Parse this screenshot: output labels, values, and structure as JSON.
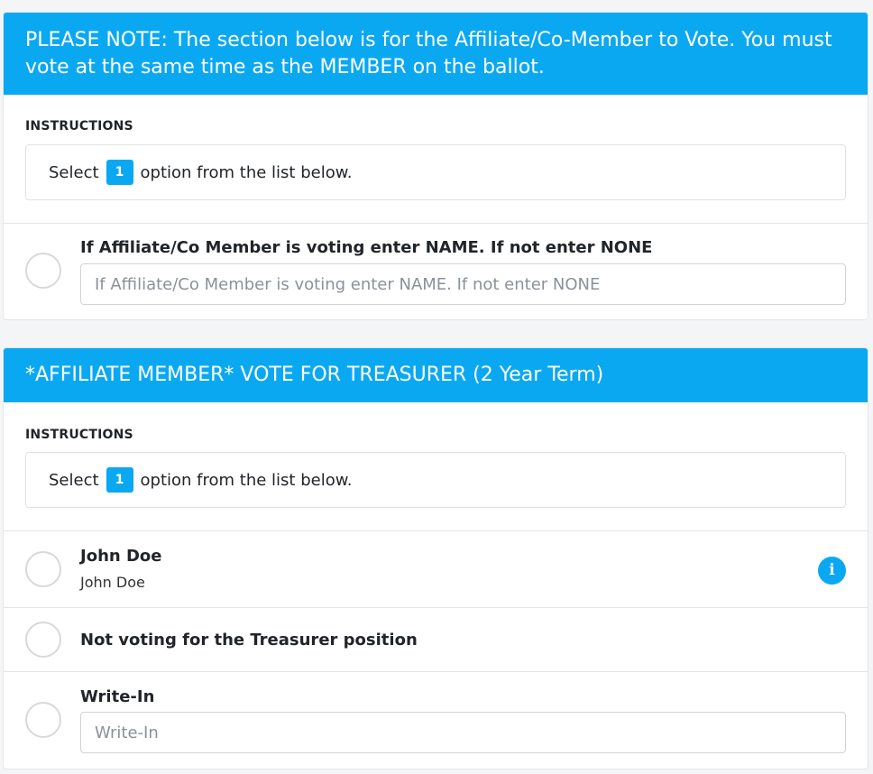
{
  "section_note": {
    "header": "PLEASE NOTE: The section below is for the Affiliate/Co-Member to Vote. You must vote at the same time as the MEMBER on the ballot.",
    "instructions_label": "INSTRUCTIONS",
    "instructions_prefix": "Select",
    "select_count": "1",
    "instructions_suffix": "option from the list below.",
    "option": {
      "title": "If Affiliate/Co Member is voting enter NAME. If not enter NONE",
      "placeholder": "If Affiliate/Co Member is voting enter NAME. If not enter NONE"
    }
  },
  "section_treasurer": {
    "header": "*AFFILIATE MEMBER* VOTE FOR TREASURER (2 Year Term)",
    "instructions_label": "INSTRUCTIONS",
    "instructions_prefix": "Select",
    "select_count": "1",
    "instructions_suffix": "option from the list below.",
    "options": [
      {
        "title": "John Doe",
        "subtitle": "John Doe",
        "icon": "info-icon"
      },
      {
        "title": "Not voting for the Treasurer position"
      },
      {
        "title": "Write-In",
        "placeholder": "Write-In"
      }
    ]
  },
  "colors": {
    "accent": "#0ba8f2",
    "background": "#f4f5f6",
    "radio_border": "#d6d9dc"
  }
}
